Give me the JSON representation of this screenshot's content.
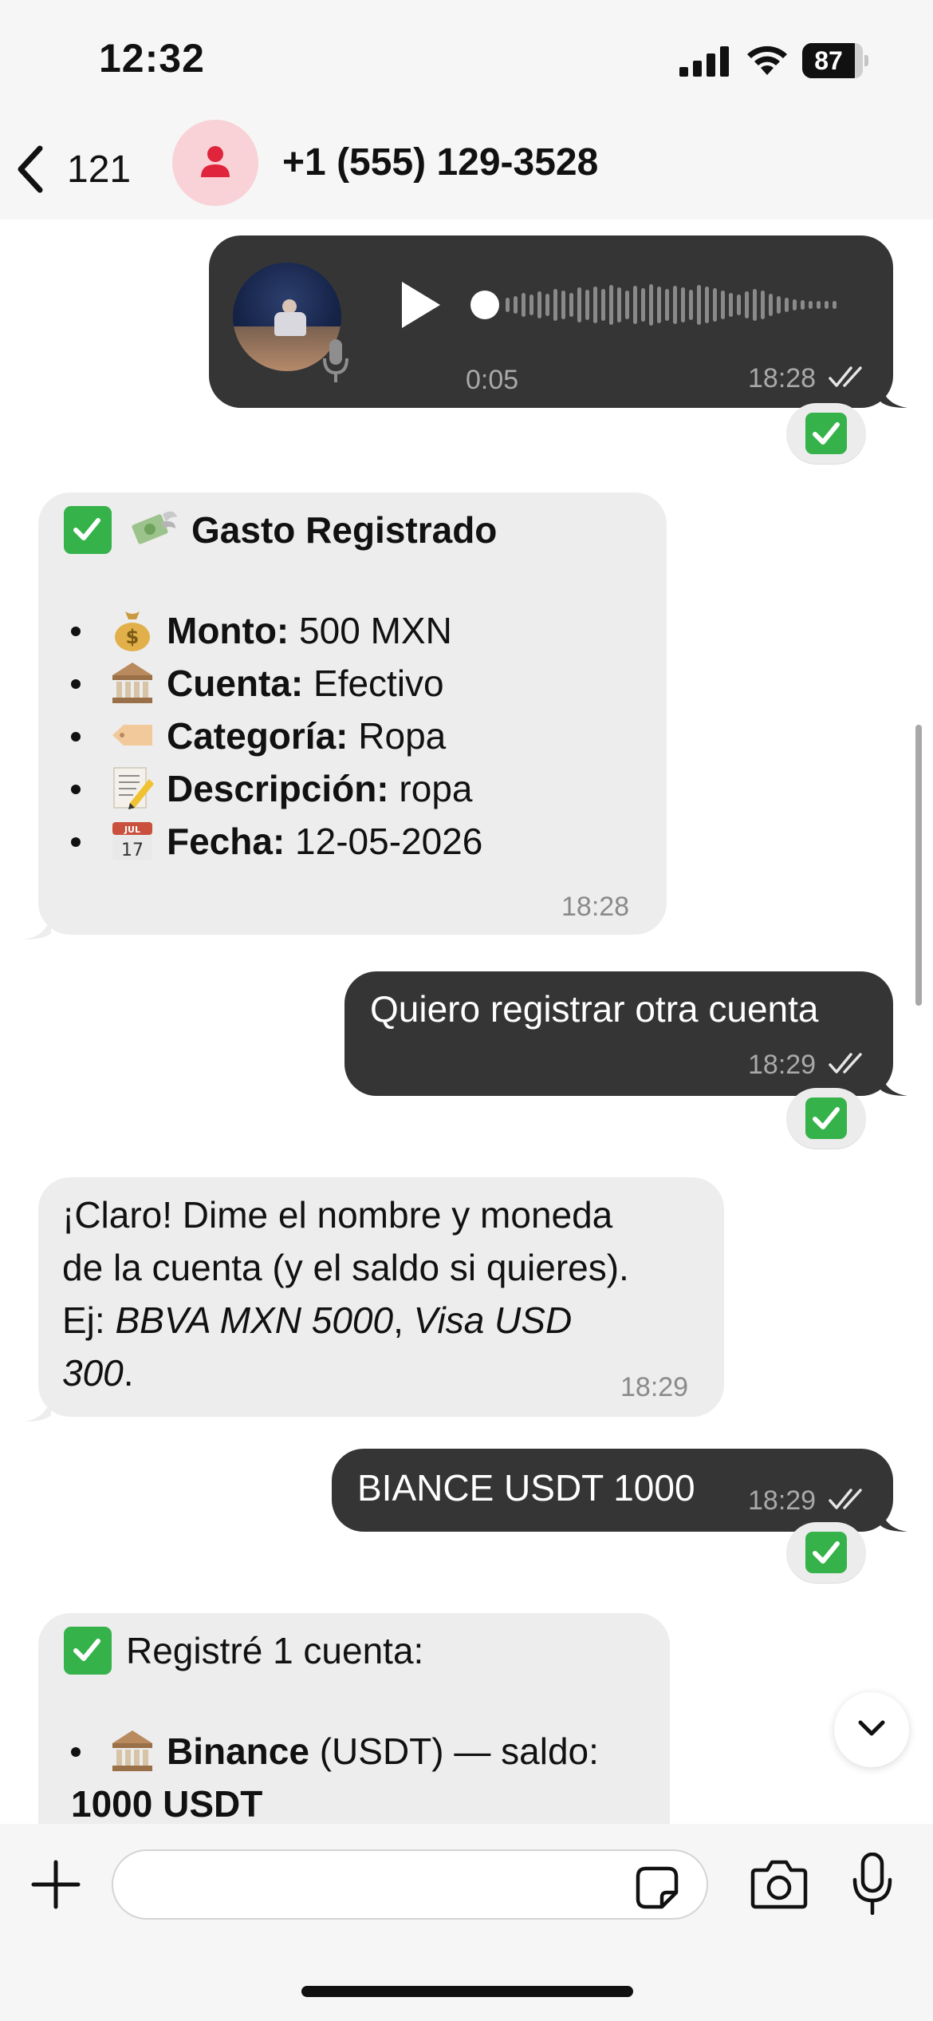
{
  "status_bar": {
    "time": "12:32",
    "battery": "87"
  },
  "header": {
    "back_count": "121",
    "contact_name": "+1 (555) 129-3528"
  },
  "messages": {
    "voice": {
      "duration": "0:05",
      "time": "18:28",
      "reaction": "check-emoji"
    },
    "expense": {
      "title": "Gasto Registrado",
      "items": [
        {
          "icon": "money-bag-emoji",
          "label": "Monto:",
          "value": " 500 MXN"
        },
        {
          "icon": "bank-emoji",
          "label": "Cuenta:",
          "value": " Efectivo"
        },
        {
          "icon": "tag-emoji",
          "label": "Categoría:",
          "value": " Ropa"
        },
        {
          "icon": "memo-emoji",
          "label": "Descripción:",
          "value": " ropa"
        },
        {
          "icon": "calendar-emoji",
          "label": "Fecha:",
          "value": " 12-05-2026"
        }
      ],
      "time": "18:28"
    },
    "request": {
      "text": "Quiero registrar otra cuenta",
      "time": "18:29"
    },
    "reply": {
      "line1": "¡Claro! Dime el nombre y moneda",
      "line2": "de la cuenta (y el saldo si quieres).",
      "line3_prefix": "Ej: ",
      "line3_italic_a": "BBVA MXN 5000",
      "line3_sep": ", ",
      "line3_italic_b": "Visa USD",
      "line4_italic": "300",
      "line4_suffix": ".",
      "time": "18:29"
    },
    "account_input": {
      "text": "BIANCE USDT 1000",
      "time": "18:29"
    },
    "confirmation": {
      "title": "Registré 1 cuenta:",
      "item_name": "Binance",
      "item_detail": " (USDT) — saldo:",
      "item_balance": "1000 USDT"
    }
  },
  "composer": {
    "placeholder": "",
    "value": ""
  }
}
